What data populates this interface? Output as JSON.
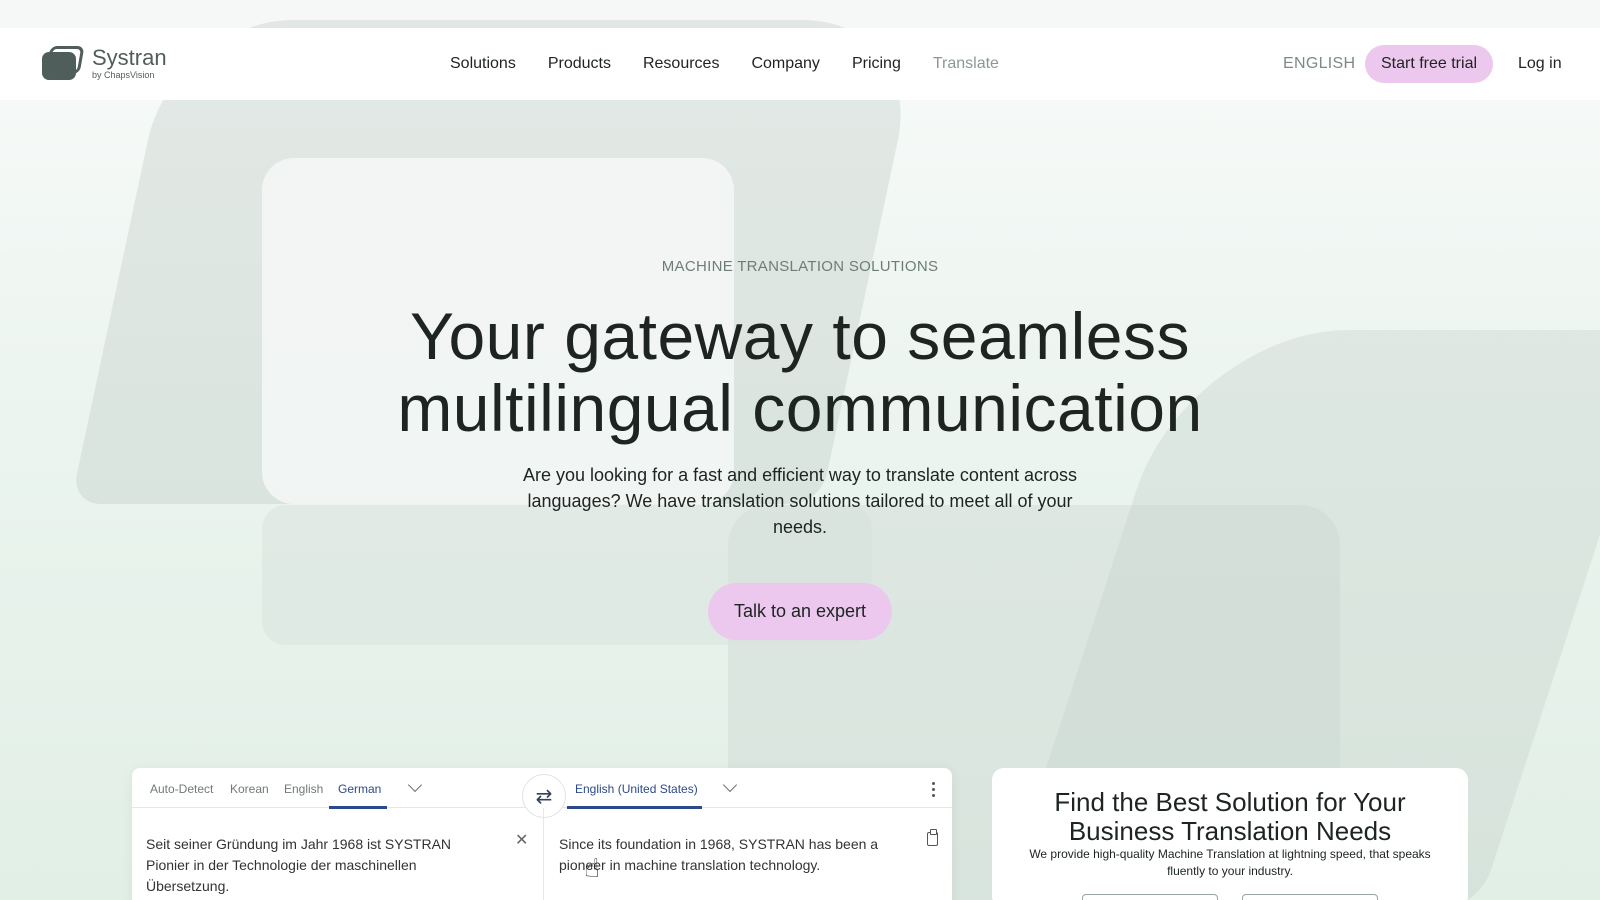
{
  "header": {
    "logo_name": "Systran",
    "logo_sub": "by ChapsVision",
    "nav": [
      "Solutions",
      "Products",
      "Resources",
      "Company",
      "Pricing",
      "Translate"
    ],
    "language": "ENGLISH",
    "trial_label": "Start free trial",
    "login_label": "Log in"
  },
  "hero": {
    "eyebrow": "MACHINE TRANSLATION SOLUTIONS",
    "headline_line1": "Your gateway to seamless",
    "headline_line2": "multilingual communication",
    "subcopy": "Are you looking for a fast and efficient way to translate content across languages? We have translation solutions tailored to meet all of your needs.",
    "cta_label": "Talk to an expert"
  },
  "translator": {
    "source_tabs": [
      "Auto-Detect",
      "Korean",
      "English",
      "German"
    ],
    "active_source": "German",
    "target_language": "English (United States)",
    "source_text": "Seit seiner Gründung im Jahr 1968 ist SYSTRAN Pionier in der Technologie der maschinellen Übersetzung.",
    "target_text": "Since its foundation in 1968, SYSTRAN has been a pioneer in machine translation technology."
  },
  "card": {
    "title": "Find the Best Solution for Your Business Translation Needs",
    "description": "We provide high-quality Machine Translation at lightning speed, that speaks fluently to your industry."
  },
  "colors": {
    "accent_pink": "#ecc8ef",
    "brand_gray": "#4f5e5a",
    "tab_active": "#2c4a8a"
  }
}
